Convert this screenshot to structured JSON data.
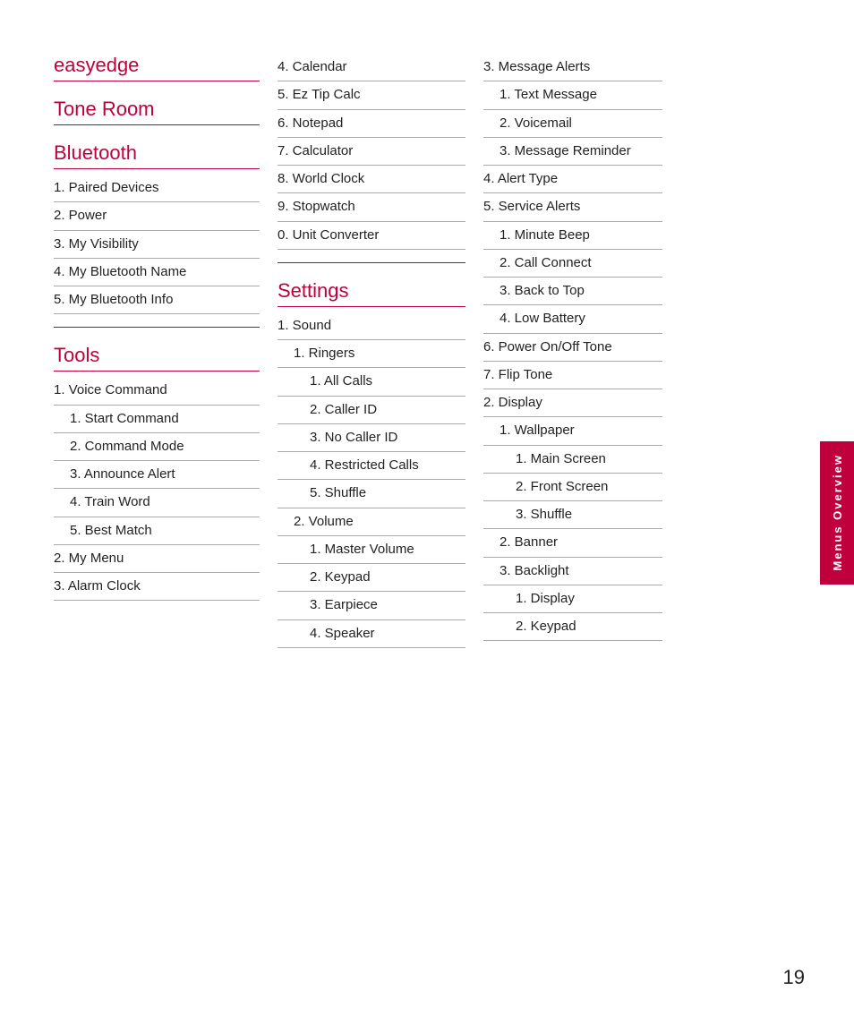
{
  "side_tab": {
    "text": "Menus Overview"
  },
  "page_number": "19",
  "col_left": {
    "sections": [
      {
        "header": "easyedge",
        "items": []
      },
      {
        "header": "Tone Room",
        "items": []
      },
      {
        "header": "Bluetooth",
        "items": [
          {
            "label": "1. Paired Devices",
            "indent": 0
          },
          {
            "label": "2. Power",
            "indent": 0
          },
          {
            "label": "3. My Visibility",
            "indent": 0
          },
          {
            "label": "4. My Bluetooth Name",
            "indent": 0
          },
          {
            "label": "5. My Bluetooth Info",
            "indent": 0
          }
        ]
      },
      {
        "header": "Tools",
        "items": [
          {
            "label": "1. Voice Command",
            "indent": 0
          },
          {
            "label": "1.  Start Command",
            "indent": 1
          },
          {
            "label": "2.  Command Mode",
            "indent": 1
          },
          {
            "label": "3. Announce Alert",
            "indent": 1
          },
          {
            "label": "4. Train Word",
            "indent": 1
          },
          {
            "label": "5. Best Match",
            "indent": 1
          },
          {
            "label": "2. My Menu",
            "indent": 0
          },
          {
            "label": "3. Alarm Clock",
            "indent": 0
          }
        ]
      }
    ]
  },
  "col_mid": {
    "sections": [
      {
        "header": null,
        "items": [
          {
            "label": "4. Calendar",
            "indent": 0
          },
          {
            "label": "5. Ez Tip Calc",
            "indent": 0
          },
          {
            "label": "6. Notepad",
            "indent": 0
          },
          {
            "label": "7. Calculator",
            "indent": 0
          },
          {
            "label": "8. World Clock",
            "indent": 0
          },
          {
            "label": "9. Stopwatch",
            "indent": 0
          },
          {
            "label": "0. Unit Converter",
            "indent": 0
          }
        ]
      },
      {
        "header": "Settings",
        "items": [
          {
            "label": "1. Sound",
            "indent": 0
          },
          {
            "label": "1. Ringers",
            "indent": 1
          },
          {
            "label": "1.  All Calls",
            "indent": 2
          },
          {
            "label": "2.  Caller ID",
            "indent": 2
          },
          {
            "label": "3.  No Caller ID",
            "indent": 2
          },
          {
            "label": "4.  Restricted Calls",
            "indent": 2
          },
          {
            "label": "5.  Shuffle",
            "indent": 2
          },
          {
            "label": "2. Volume",
            "indent": 1
          },
          {
            "label": "1.  Master Volume",
            "indent": 2
          },
          {
            "label": "2.  Keypad",
            "indent": 2
          },
          {
            "label": "3.  Earpiece",
            "indent": 2
          },
          {
            "label": "4.  Speaker",
            "indent": 2
          }
        ]
      }
    ]
  },
  "col_right": {
    "sections": [
      {
        "header": null,
        "items": [
          {
            "label": "3. Message Alerts",
            "indent": 0
          },
          {
            "label": "1.  Text Message",
            "indent": 1
          },
          {
            "label": "2.  Voicemail",
            "indent": 1
          },
          {
            "label": "3.  Message Reminder",
            "indent": 1
          },
          {
            "label": "4. Alert Type",
            "indent": 0
          },
          {
            "label": "5. Service Alerts",
            "indent": 0
          },
          {
            "label": "1.  Minute Beep",
            "indent": 1
          },
          {
            "label": "2.  Call Connect",
            "indent": 1
          },
          {
            "label": "3.  Back to Top",
            "indent": 1
          },
          {
            "label": "4.  Low Battery",
            "indent": 1
          },
          {
            "label": "6. Power On/Off Tone",
            "indent": 0
          },
          {
            "label": "7.  Flip Tone",
            "indent": 0
          },
          {
            "label": "2. Display",
            "indent": 0
          },
          {
            "label": "1. Wallpaper",
            "indent": 1
          },
          {
            "label": "1.  Main Screen",
            "indent": 2
          },
          {
            "label": "2.  Front Screen",
            "indent": 2
          },
          {
            "label": "3.  Shuffle",
            "indent": 2
          },
          {
            "label": "2. Banner",
            "indent": 1
          },
          {
            "label": "3. Backlight",
            "indent": 1
          },
          {
            "label": "1.  Display",
            "indent": 2
          },
          {
            "label": "2.  Keypad",
            "indent": 2
          }
        ]
      }
    ]
  }
}
